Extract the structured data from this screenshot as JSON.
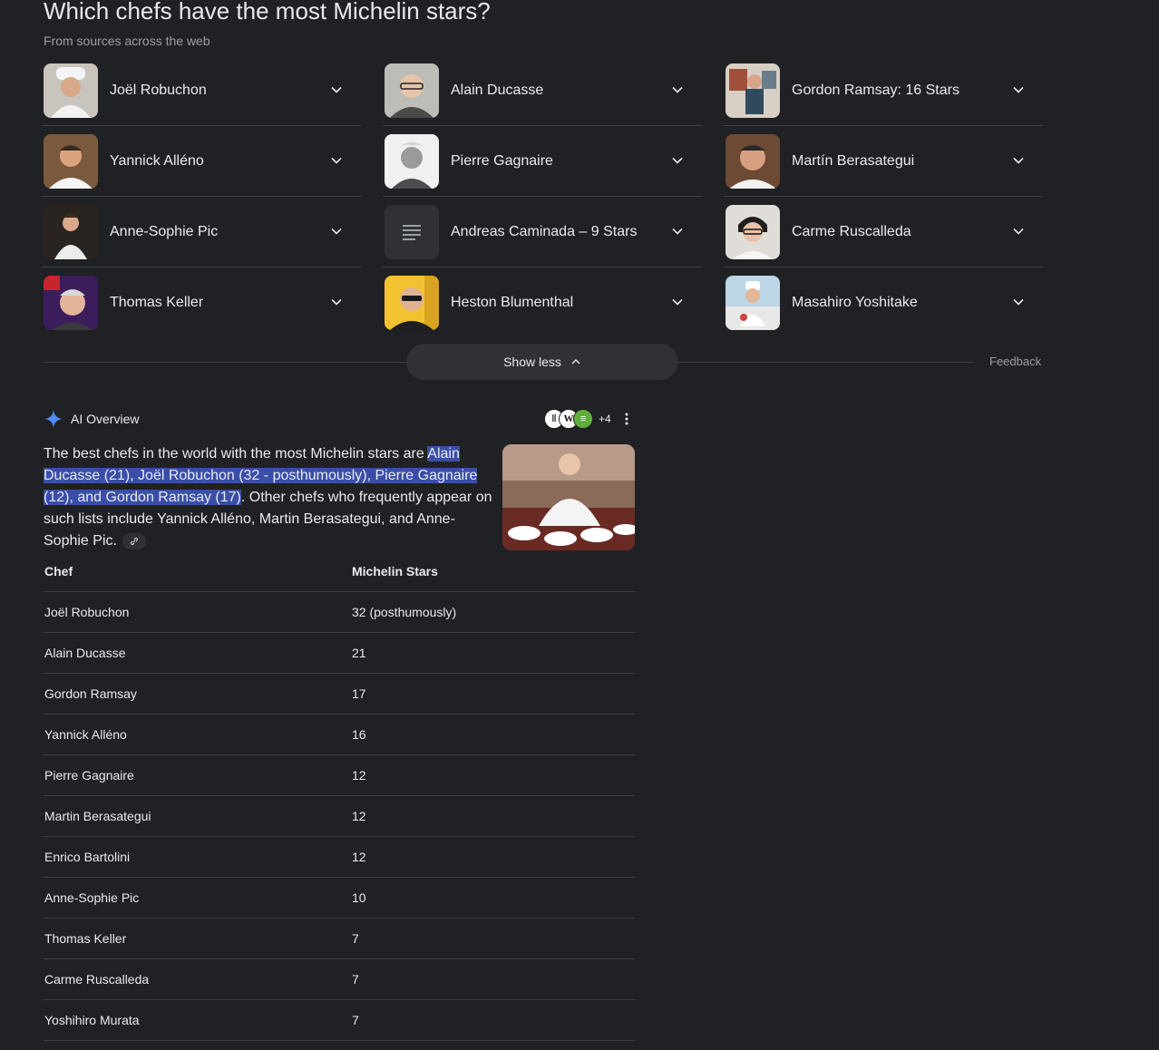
{
  "page": {
    "title": "Which chefs have the most Michelin stars?",
    "subtitle": "From sources across the web"
  },
  "chefs": [
    {
      "name": "Joël Robuchon",
      "icon": "chef-photo"
    },
    {
      "name": "Alain Ducasse",
      "icon": "chef-photo"
    },
    {
      "name": "Gordon Ramsay: 16 Stars",
      "icon": "chef-photo"
    },
    {
      "name": "Yannick Alléno",
      "icon": "chef-photo"
    },
    {
      "name": "Pierre Gagnaire",
      "icon": "chef-photo"
    },
    {
      "name": "Martín Berasategui",
      "icon": "chef-photo"
    },
    {
      "name": "Anne-Sophie Pic",
      "icon": "chef-photo"
    },
    {
      "name": "Andreas Caminada – 9 Stars",
      "icon": "document-icon"
    },
    {
      "name": "Carme Ruscalleda",
      "icon": "chef-photo"
    },
    {
      "name": "Thomas Keller",
      "icon": "chef-photo"
    },
    {
      "name": "Heston Blumenthal",
      "icon": "chef-photo"
    },
    {
      "name": "Masahiro Yoshitake",
      "icon": "chef-photo"
    }
  ],
  "show_less": "Show less",
  "feedback": "Feedback",
  "ai_overview": {
    "label": "AI Overview",
    "sources_more": "+4",
    "text_before": "The best chefs in the world with the most Michelin stars are ",
    "text_highlight": "Alain Ducasse (21), Joël Robuchon (32 - posthumously), Pierre Gagnaire (12), and Gordon Ramsay (17)",
    "text_after": ". Other chefs who frequently appear on such lists include Yannick Alléno, Martin Berasategui, and Anne-Sophie Pic."
  },
  "table": {
    "headers": [
      "Chef",
      "Michelin Stars"
    ],
    "rows": [
      [
        "Joël Robuchon",
        "32 (posthumously)"
      ],
      [
        "Alain Ducasse",
        "21"
      ],
      [
        "Gordon Ramsay",
        "17"
      ],
      [
        "Yannick Alléno",
        "16"
      ],
      [
        "Pierre Gagnaire",
        "12"
      ],
      [
        "Martin Berasategui",
        "12"
      ],
      [
        "Enrico Bartolini",
        "12"
      ],
      [
        "Anne-Sophie Pic",
        "10"
      ],
      [
        "Thomas Keller",
        "7"
      ],
      [
        "Carme Ruscalleda",
        "7"
      ],
      [
        "Yoshihiro Murata",
        "7"
      ]
    ]
  },
  "colors": {
    "background": "#202124",
    "text": "#e8eaed",
    "muted": "#9aa0a6",
    "highlight": "#3a4ea8",
    "divider": "#3c4043"
  }
}
